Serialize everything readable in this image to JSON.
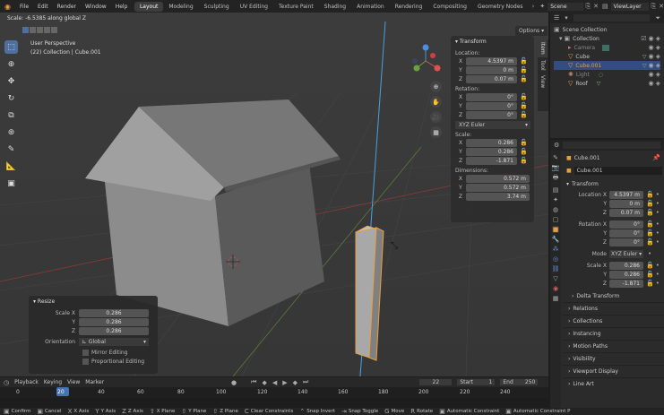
{
  "topbar": {
    "menus": [
      "File",
      "Edit",
      "Render",
      "Window",
      "Help"
    ],
    "workspaces": [
      "Layout",
      "Modeling",
      "Sculpting",
      "UV Editing",
      "Texture Paint",
      "Shading",
      "Animation",
      "Rendering",
      "Compositing",
      "Geometry Nodes"
    ],
    "active_workspace": "Layout",
    "scene": "Scene",
    "view_layer": "ViewLayer"
  },
  "viewport": {
    "status": "Scale: -6.5385 along global Z",
    "view_name": "User Perspective",
    "view_object": "(22) Collection | Cube.001",
    "options_label": "Options",
    "side_tabs": [
      "Item",
      "Tool",
      "View"
    ]
  },
  "transform_panel": {
    "title": "Transform",
    "location_label": "Location:",
    "location": [
      {
        "axis": "X",
        "value": "4.5397 m"
      },
      {
        "axis": "Y",
        "value": "0 m"
      },
      {
        "axis": "Z",
        "value": "0.07 m"
      }
    ],
    "rotation_label": "Rotation:",
    "rotation": [
      {
        "axis": "X",
        "value": "0°"
      },
      {
        "axis": "Y",
        "value": "0°"
      },
      {
        "axis": "Z",
        "value": "0°"
      }
    ],
    "rotation_mode": "XYZ Euler",
    "scale_label": "Scale:",
    "scale": [
      {
        "axis": "X",
        "value": "0.286"
      },
      {
        "axis": "Y",
        "value": "0.286"
      },
      {
        "axis": "Z",
        "value": "-1.871"
      }
    ],
    "dimensions_label": "Dimensions:",
    "dimensions": [
      {
        "axis": "X",
        "value": "0.572 m"
      },
      {
        "axis": "Y",
        "value": "0.572 m"
      },
      {
        "axis": "Z",
        "value": "3.74 m"
      }
    ]
  },
  "resize_panel": {
    "title": "Resize",
    "scale_x_label": "Scale X",
    "scale_x": "0.286",
    "y_label": "Y",
    "scale_y": "0.286",
    "z_label": "Z",
    "scale_z": "0.286",
    "orientation_label": "Orientation",
    "orientation": "Global",
    "mirror_label": "Mirror Editing",
    "proportional_label": "Proportional Editing"
  },
  "outliner": {
    "root": "Scene Collection",
    "collection": "Collection",
    "items": [
      {
        "name": "Camera",
        "color": "#c08070"
      },
      {
        "name": "Cube",
        "color": "#e8a040"
      },
      {
        "name": "Cube.001",
        "color": "#e8a040"
      },
      {
        "name": "Light",
        "color": "#c08070"
      },
      {
        "name": "Roof",
        "color": "#e8a040"
      }
    ]
  },
  "properties": {
    "breadcrumb": "Cube.001",
    "object_name": "Cube.001",
    "transform_title": "Transform",
    "location_x_label": "Location X",
    "loc_x": "4.5397 m",
    "y_label": "Y",
    "loc_y": "0 m",
    "z_label": "Z",
    "loc_z": "0.07 m",
    "rotation_x_label": "Rotation X",
    "rot_x": "0°",
    "rot_y": "0°",
    "rot_z": "0°",
    "mode_label": "Mode",
    "mode": "XYZ Euler",
    "scale_x_label": "Scale X",
    "scl_x": "0.286",
    "scl_y": "0.286",
    "scl_z": "-1.871",
    "delta_transform": "Delta Transform",
    "sections": [
      "Relations",
      "Collections",
      "Instancing",
      "Motion Paths",
      "Visibility",
      "Viewport Display",
      "Line Art"
    ]
  },
  "timeline": {
    "menus": [
      "Playback",
      "Keying",
      "View",
      "Marker"
    ],
    "current_frame": "22",
    "start_label": "Start",
    "start": "1",
    "end_label": "End",
    "end": "250",
    "ruler": [
      "0",
      "20",
      "40",
      "60",
      "80",
      "100",
      "120",
      "140",
      "160",
      "180",
      "200",
      "220",
      "240"
    ]
  },
  "statusbar": [
    "Confirm",
    "Cancel",
    "X Axis",
    "Y Axis",
    "Z Axis",
    "X Plane",
    "Y Plane",
    "Z Plane",
    "Clear Constraints",
    "Snap Invert",
    "Snap Toggle",
    "Move",
    "Rotate",
    "Automatic Constraint",
    "Automatic Constraint P"
  ],
  "colors": {
    "accent": "#4772b3",
    "active_object": "#e8a040",
    "selection": "#4f6f9f"
  }
}
